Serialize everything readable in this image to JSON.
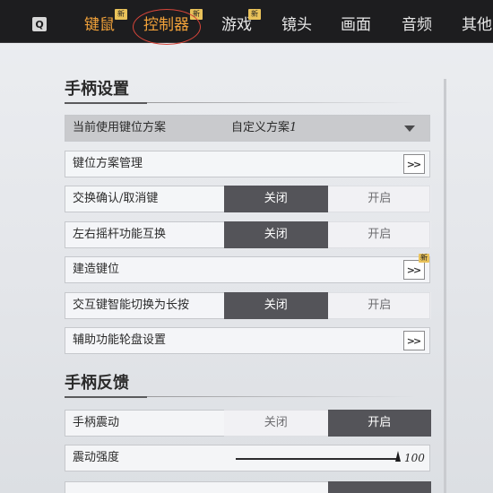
{
  "topbar": {
    "q_key": "Q",
    "tabs": [
      {
        "label": "键鼠",
        "badge": "新"
      },
      {
        "label": "控制器",
        "badge": "新"
      },
      {
        "label": "游戏",
        "badge": "新"
      },
      {
        "label": "镜头"
      },
      {
        "label": "画面"
      },
      {
        "label": "音频"
      },
      {
        "label": "其他"
      }
    ],
    "active_tab": "控制器",
    "accent_color": "#f2a23a",
    "highlight_color": "#d8453a"
  },
  "gamepad_settings": {
    "title": "手柄设置",
    "current_scheme": {
      "label": "当前使用键位方案",
      "value_text": "自定义方案",
      "value_num": "1"
    },
    "scheme_manage": {
      "label": "键位方案管理",
      "button": ">>"
    },
    "swap_confirm": {
      "label": "交换确认/取消键",
      "off": "关闭",
      "on": "开启",
      "selected": "关闭"
    },
    "swap_stick": {
      "label": "左右摇杆功能互换",
      "off": "关闭",
      "on": "开启",
      "selected": "关闭"
    },
    "build_keys": {
      "label": "建造键位",
      "button": ">>",
      "badge": "新"
    },
    "interact_long": {
      "label": "交互键智能切换为长按",
      "off": "关闭",
      "on": "开启",
      "selected": "关闭"
    },
    "assist_wheel": {
      "label": "辅助功能轮盘设置",
      "button": ">>"
    }
  },
  "gamepad_feedback": {
    "title": "手柄反馈",
    "vibration": {
      "label": "手柄震动",
      "off": "关闭",
      "on": "开启",
      "selected": "开启"
    },
    "intensity": {
      "label": "震动强度",
      "value": "100",
      "fraction": 1.0
    }
  }
}
